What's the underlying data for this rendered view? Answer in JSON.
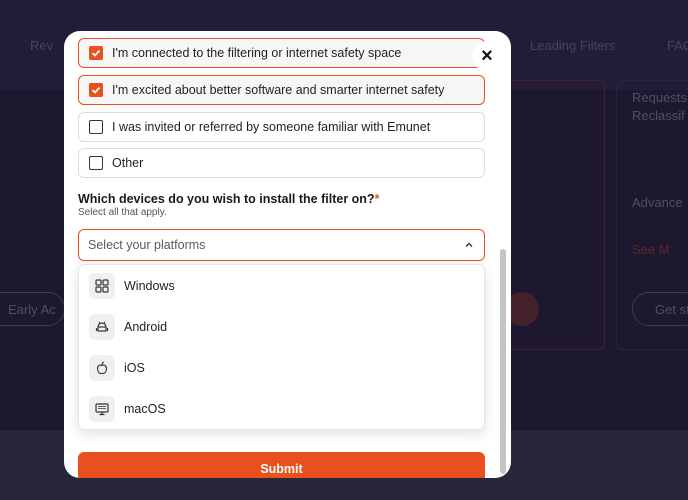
{
  "background": {
    "nav_items": [
      "Rev",
      "Leading Filters",
      "FAQ"
    ],
    "side_texts": [
      "Requests",
      "Reclassif",
      "Advance",
      "See M",
      "Get st"
    ],
    "early_access": "Early Ac"
  },
  "modal": {
    "close_label": "×",
    "options": [
      {
        "label": "I'm connected to the filtering or internet safety space",
        "checked": true
      },
      {
        "label": "I'm excited about better software and smarter internet safety",
        "checked": true
      },
      {
        "label": "I was invited or referred by someone familiar with Emunet",
        "checked": false
      },
      {
        "label": "Other",
        "checked": false
      }
    ],
    "question": "Which devices do you wish to install the filter on?",
    "required_mark": "*",
    "question_hint": "Select all that apply.",
    "select_placeholder": "Select your platforms",
    "platforms": [
      {
        "label": "Windows",
        "icon": "windows-icon"
      },
      {
        "label": "Android",
        "icon": "android-icon"
      },
      {
        "label": "iOS",
        "icon": "apple-icon"
      },
      {
        "label": "macOS",
        "icon": "monitor-icon"
      }
    ],
    "submit_label": "Submit"
  },
  "colors": {
    "accent": "#e8501e",
    "modal_bg": "#ffffff",
    "page_bg": "#221d38"
  }
}
